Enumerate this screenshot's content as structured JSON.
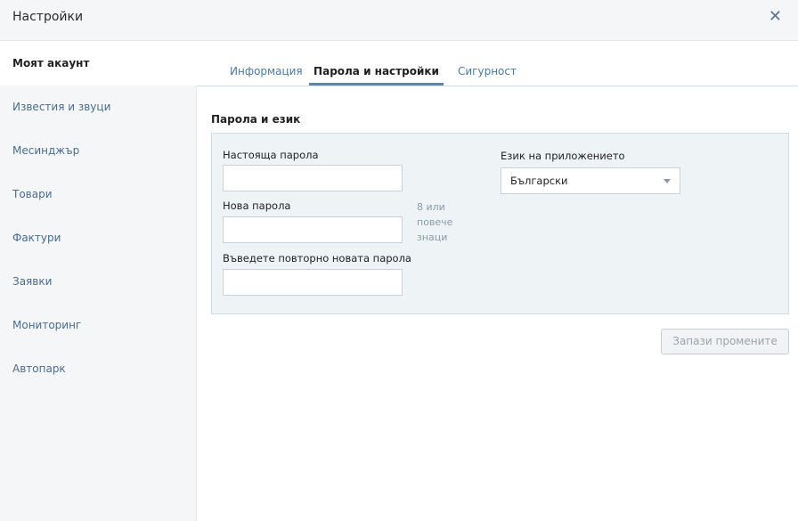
{
  "header": {
    "title": "Настройки",
    "close_glyph": "✕",
    "close_icon": "close-icon"
  },
  "sidebar": {
    "items": [
      {
        "label": "Моят акаунт",
        "active": true
      },
      {
        "label": "Известия и звуци",
        "active": false
      },
      {
        "label": "Месинджър",
        "active": false
      },
      {
        "label": "Товари",
        "active": false
      },
      {
        "label": "Фактури",
        "active": false
      },
      {
        "label": "Заявки",
        "active": false
      },
      {
        "label": "Мониторинг",
        "active": false
      },
      {
        "label": "Автопарк",
        "active": false
      }
    ]
  },
  "tabs": [
    {
      "label": "Информация",
      "active": false
    },
    {
      "label": "Парола и настройки",
      "active": true
    },
    {
      "label": "Сигурност",
      "active": false
    }
  ],
  "section": {
    "title": "Парола и език",
    "current_password_label": "Настояща парола",
    "current_password_value": "",
    "new_password_label": "Нова парола",
    "new_password_value": "",
    "password_hint": "8 или повече знаци",
    "repeat_password_label": "Въведете повторно новата парола",
    "repeat_password_value": "",
    "language_label": "Език на приложението",
    "language_value": "Български",
    "language_dropdown_icon": "chevron-down-icon"
  },
  "actions": {
    "save_label": "Запази промените"
  },
  "colors": {
    "accent": "#5a88ad",
    "link": "#4a7aa5",
    "panel_bg": "#eef3f6",
    "sidebar_bg": "#f4f6f8"
  }
}
